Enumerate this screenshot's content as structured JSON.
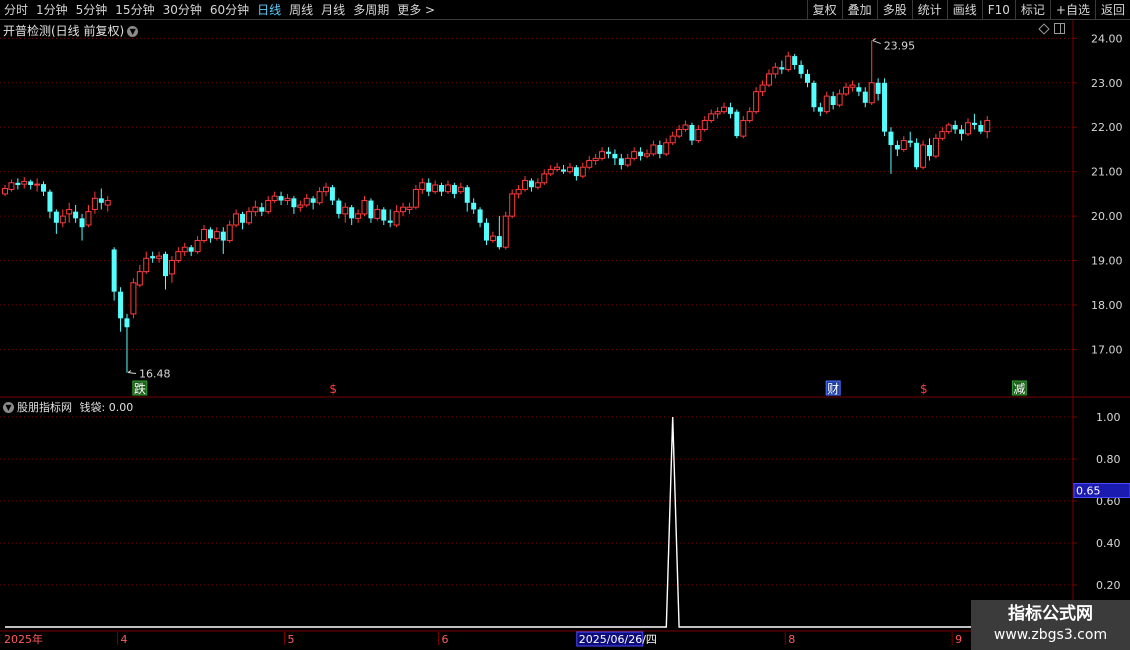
{
  "toolbar": {
    "periods": [
      "分时",
      "1分钟",
      "5分钟",
      "15分钟",
      "30分钟",
      "60分钟",
      "日线",
      "周线",
      "月线",
      "多周期",
      "更多 >"
    ],
    "active_period": "日线",
    "tools": [
      "复权",
      "叠加",
      "多股",
      "统计",
      "画线",
      "F10",
      "标记",
      "+自选",
      "返回"
    ]
  },
  "main_panel": {
    "title": "开普检测(日线 前复权)",
    "high_label": "23.95",
    "low_label": "16.48",
    "markers": [
      {
        "text": "跌",
        "style": "box-green"
      },
      {
        "text": "$",
        "style": "red"
      },
      {
        "text": "财",
        "style": "box-blue"
      },
      {
        "text": "$",
        "style": "red"
      },
      {
        "text": "减",
        "style": "box-green"
      }
    ]
  },
  "indicator_panel": {
    "title": "股朋指标网",
    "series_label": "钱袋:",
    "series_value": "0.00",
    "current_marker": "0.65"
  },
  "x_axis": {
    "labels": [
      "2025年",
      "4",
      "5",
      "6",
      "2025/06/26/四",
      "8",
      "9"
    ],
    "highlight": "2025/06/26/四"
  },
  "watermark": {
    "title": "指标公式网",
    "url": "www.zbgs3.com"
  },
  "colors": {
    "up": "#ff3b3b",
    "down": "#54ffff",
    "grid": "#6e0000",
    "axis": "#7a0000",
    "active_tab": "#5bd1ff"
  },
  "chart_data": [
    {
      "type": "candlestick",
      "title": "开普检测(日线 前复权)",
      "ylim": [
        16.2,
        24.3
      ],
      "y_ticks": [
        "17.00",
        "18.00",
        "19.00",
        "20.00",
        "21.00",
        "22.00",
        "23.00",
        "24.00"
      ],
      "annotations": [
        {
          "text": "23.95",
          "value": 23.95
        },
        {
          "text": "16.48",
          "value": 16.48
        }
      ],
      "candles": [
        [
          20.5,
          20.62,
          20.45,
          20.7
        ],
        [
          20.6,
          20.75,
          20.55,
          20.82
        ],
        [
          20.75,
          20.7,
          20.6,
          20.85
        ],
        [
          20.72,
          20.78,
          20.62,
          20.88
        ],
        [
          20.78,
          20.7,
          20.6,
          20.82
        ],
        [
          20.7,
          20.72,
          20.55,
          20.85
        ],
        [
          20.72,
          20.55,
          20.45,
          20.78
        ],
        [
          20.55,
          20.1,
          19.95,
          20.6
        ],
        [
          20.1,
          19.85,
          19.6,
          20.15
        ],
        [
          19.85,
          20.0,
          19.75,
          20.15
        ],
        [
          20.05,
          20.15,
          19.85,
          20.3
        ],
        [
          20.1,
          19.95,
          19.85,
          20.25
        ],
        [
          19.95,
          19.75,
          19.45,
          20.05
        ],
        [
          19.8,
          20.1,
          19.75,
          20.25
        ],
        [
          20.15,
          20.4,
          20.05,
          20.55
        ],
        [
          20.4,
          20.3,
          20.15,
          20.62
        ],
        [
          20.25,
          20.35,
          20.1,
          20.45
        ],
        [
          19.25,
          18.3,
          18.1,
          19.3
        ],
        [
          18.3,
          17.7,
          17.4,
          18.4
        ],
        [
          17.7,
          17.5,
          16.48,
          17.8
        ],
        [
          17.8,
          18.5,
          17.7,
          18.6
        ],
        [
          18.45,
          18.75,
          18.4,
          18.9
        ],
        [
          18.75,
          19.05,
          18.7,
          19.2
        ],
        [
          19.1,
          19.05,
          18.95,
          19.2
        ],
        [
          19.05,
          19.1,
          18.95,
          19.2
        ],
        [
          19.15,
          18.65,
          18.35,
          19.2
        ],
        [
          18.7,
          19.0,
          18.5,
          19.1
        ],
        [
          19.0,
          19.2,
          18.95,
          19.3
        ],
        [
          19.2,
          19.3,
          19.1,
          19.4
        ],
        [
          19.3,
          19.2,
          19.1,
          19.35
        ],
        [
          19.2,
          19.45,
          19.15,
          19.55
        ],
        [
          19.45,
          19.7,
          19.4,
          19.8
        ],
        [
          19.7,
          19.5,
          19.4,
          19.75
        ],
        [
          19.5,
          19.65,
          19.45,
          19.75
        ],
        [
          19.65,
          19.45,
          19.15,
          19.75
        ],
        [
          19.45,
          19.8,
          19.4,
          19.9
        ],
        [
          19.8,
          20.05,
          19.75,
          20.15
        ],
        [
          20.05,
          19.85,
          19.7,
          20.1
        ],
        [
          19.85,
          20.1,
          19.8,
          20.2
        ],
        [
          20.1,
          20.2,
          20.0,
          20.35
        ],
        [
          20.2,
          20.1,
          20.0,
          20.3
        ],
        [
          20.1,
          20.35,
          20.05,
          20.45
        ],
        [
          20.35,
          20.45,
          20.3,
          20.55
        ],
        [
          20.45,
          20.35,
          20.25,
          20.55
        ],
        [
          20.35,
          20.4,
          20.25,
          20.5
        ],
        [
          20.4,
          20.2,
          20.05,
          20.45
        ],
        [
          20.2,
          20.25,
          20.1,
          20.35
        ],
        [
          20.25,
          20.4,
          20.2,
          20.5
        ],
        [
          20.4,
          20.3,
          20.15,
          20.45
        ],
        [
          20.3,
          20.55,
          20.25,
          20.65
        ],
        [
          20.55,
          20.65,
          20.45,
          20.75
        ],
        [
          20.65,
          20.35,
          20.25,
          20.7
        ],
        [
          20.35,
          20.05,
          19.95,
          20.4
        ],
        [
          20.05,
          20.2,
          19.85,
          20.3
        ],
        [
          20.2,
          19.95,
          19.8,
          20.25
        ],
        [
          19.95,
          20.05,
          19.85,
          20.15
        ],
        [
          20.05,
          20.35,
          20.0,
          20.45
        ],
        [
          20.35,
          19.95,
          19.85,
          20.4
        ],
        [
          19.95,
          20.15,
          19.9,
          20.25
        ],
        [
          20.15,
          19.9,
          19.8,
          20.2
        ],
        [
          19.9,
          19.85,
          19.75,
          20.15
        ],
        [
          19.8,
          20.1,
          19.75,
          20.25
        ],
        [
          20.1,
          20.2,
          20.0,
          20.3
        ],
        [
          20.15,
          20.2,
          20.05,
          20.3
        ],
        [
          20.2,
          20.6,
          20.15,
          20.7
        ],
        [
          20.6,
          20.75,
          20.5,
          20.85
        ],
        [
          20.75,
          20.55,
          20.45,
          20.85
        ],
        [
          20.55,
          20.7,
          20.5,
          20.8
        ],
        [
          20.7,
          20.55,
          20.45,
          20.75
        ],
        [
          20.55,
          20.7,
          20.5,
          20.8
        ],
        [
          20.7,
          20.5,
          20.4,
          20.75
        ],
        [
          20.55,
          20.65,
          20.5,
          20.75
        ],
        [
          20.65,
          20.3,
          20.1,
          20.7
        ],
        [
          20.3,
          20.15,
          20.05,
          20.4
        ],
        [
          20.15,
          19.85,
          19.75,
          20.2
        ],
        [
          19.85,
          19.45,
          19.35,
          19.95
        ],
        [
          19.45,
          19.55,
          19.4,
          19.65
        ],
        [
          19.55,
          19.3,
          19.25,
          20.0
        ],
        [
          19.3,
          20.0,
          19.25,
          20.1
        ],
        [
          20.0,
          20.5,
          19.95,
          20.6
        ],
        [
          20.5,
          20.6,
          20.4,
          20.7
        ],
        [
          20.6,
          20.8,
          20.55,
          20.9
        ],
        [
          20.8,
          20.65,
          20.55,
          20.85
        ],
        [
          20.65,
          20.75,
          20.6,
          20.85
        ],
        [
          20.75,
          20.95,
          20.7,
          21.05
        ],
        [
          20.95,
          21.05,
          20.9,
          21.15
        ],
        [
          21.05,
          21.1,
          21.0,
          21.2
        ],
        [
          21.05,
          21.0,
          20.95,
          21.15
        ],
        [
          21.0,
          21.1,
          20.95,
          21.2
        ],
        [
          21.1,
          20.9,
          20.8,
          21.15
        ],
        [
          20.9,
          21.1,
          20.85,
          21.2
        ],
        [
          21.1,
          21.25,
          21.05,
          21.35
        ],
        [
          21.25,
          21.3,
          21.15,
          21.4
        ],
        [
          21.3,
          21.45,
          21.25,
          21.55
        ],
        [
          21.45,
          21.4,
          21.3,
          21.55
        ],
        [
          21.4,
          21.3,
          21.15,
          21.5
        ],
        [
          21.3,
          21.15,
          21.05,
          21.4
        ],
        [
          21.15,
          21.3,
          21.1,
          21.4
        ],
        [
          21.3,
          21.45,
          21.25,
          21.55
        ],
        [
          21.45,
          21.35,
          21.25,
          21.55
        ],
        [
          21.35,
          21.4,
          21.3,
          21.5
        ],
        [
          21.4,
          21.6,
          21.35,
          21.7
        ],
        [
          21.6,
          21.4,
          21.3,
          21.7
        ],
        [
          21.4,
          21.65,
          21.35,
          21.75
        ],
        [
          21.65,
          21.8,
          21.6,
          21.9
        ],
        [
          21.8,
          21.95,
          21.75,
          22.05
        ],
        [
          21.95,
          22.05,
          21.9,
          22.15
        ],
        [
          22.05,
          21.7,
          21.6,
          22.1
        ],
        [
          21.7,
          21.95,
          21.65,
          22.05
        ],
        [
          21.95,
          22.15,
          21.9,
          22.25
        ],
        [
          22.15,
          22.3,
          22.1,
          22.4
        ],
        [
          22.3,
          22.35,
          22.2,
          22.45
        ],
        [
          22.35,
          22.45,
          22.3,
          22.55
        ],
        [
          22.45,
          22.3,
          22.2,
          22.55
        ],
        [
          22.35,
          21.8,
          21.75,
          22.4
        ],
        [
          21.8,
          22.15,
          21.75,
          22.25
        ],
        [
          22.15,
          22.35,
          22.1,
          22.45
        ],
        [
          22.35,
          22.8,
          22.3,
          22.9
        ],
        [
          22.8,
          22.95,
          22.7,
          23.05
        ],
        [
          22.95,
          23.2,
          22.9,
          23.3
        ],
        [
          23.2,
          23.35,
          23.1,
          23.45
        ],
        [
          23.35,
          23.3,
          23.2,
          23.5
        ],
        [
          23.3,
          23.6,
          23.25,
          23.7
        ],
        [
          23.6,
          23.4,
          23.3,
          23.65
        ],
        [
          23.4,
          23.2,
          23.1,
          23.5
        ],
        [
          23.2,
          23.0,
          22.9,
          23.3
        ],
        [
          23.0,
          22.45,
          22.35,
          23.05
        ],
        [
          22.45,
          22.35,
          22.25,
          22.55
        ],
        [
          22.35,
          22.7,
          22.3,
          22.8
        ],
        [
          22.7,
          22.5,
          22.4,
          22.8
        ],
        [
          22.5,
          22.75,
          22.45,
          22.85
        ],
        [
          22.75,
          22.9,
          22.7,
          23.0
        ],
        [
          22.9,
          22.95,
          22.8,
          23.05
        ],
        [
          22.9,
          22.8,
          22.7,
          23.0
        ],
        [
          22.8,
          22.55,
          22.45,
          22.9
        ],
        [
          22.55,
          23.0,
          22.5,
          23.95
        ],
        [
          23.0,
          22.75,
          22.6,
          23.1
        ],
        [
          23.0,
          21.9,
          21.8,
          23.1
        ],
        [
          21.9,
          21.6,
          20.95,
          22.0
        ],
        [
          21.6,
          21.5,
          21.35,
          21.7
        ],
        [
          21.5,
          21.7,
          21.45,
          21.8
        ],
        [
          21.7,
          21.65,
          21.55,
          21.9
        ],
        [
          21.65,
          21.1,
          21.05,
          21.75
        ],
        [
          21.1,
          21.6,
          21.05,
          21.7
        ],
        [
          21.6,
          21.35,
          21.25,
          21.75
        ],
        [
          21.35,
          21.75,
          21.3,
          21.85
        ],
        [
          21.75,
          21.9,
          21.7,
          22.0
        ],
        [
          21.9,
          22.05,
          21.85,
          22.1
        ],
        [
          22.05,
          21.95,
          21.85,
          22.15
        ],
        [
          21.95,
          21.85,
          21.7,
          22.05
        ],
        [
          21.85,
          22.1,
          21.8,
          22.2
        ],
        [
          22.1,
          22.05,
          21.95,
          22.3
        ],
        [
          22.05,
          21.9,
          21.85,
          22.15
        ],
        [
          21.9,
          22.15,
          21.75,
          22.25
        ]
      ]
    },
    {
      "type": "line",
      "title": "股朋指标网",
      "series": [
        {
          "name": "钱袋",
          "values": [
            0,
            0,
            0,
            0,
            0,
            0,
            0,
            0,
            0,
            0,
            0,
            0,
            0,
            0,
            0,
            0,
            0,
            0,
            0,
            0,
            0,
            0,
            0,
            0,
            0,
            0,
            0,
            0,
            0,
            0,
            0,
            0,
            0,
            0,
            0,
            0,
            0,
            0,
            0,
            0,
            0,
            0,
            0,
            0,
            0,
            0,
            0,
            0,
            0,
            0,
            0,
            0,
            0,
            0,
            0,
            0,
            0,
            0,
            0,
            0,
            0,
            0,
            0,
            0,
            0,
            0,
            0,
            0,
            0,
            0,
            0,
            0,
            0,
            0,
            0,
            0,
            0,
            0,
            0,
            0,
            0,
            0,
            0,
            0,
            0,
            0,
            0,
            0,
            0,
            0,
            0,
            0,
            0,
            0,
            0,
            0,
            0,
            0,
            0,
            0,
            0,
            0,
            0,
            0,
            1,
            0,
            0,
            0,
            0,
            0,
            0,
            0,
            0,
            0,
            0,
            0,
            0,
            0,
            0,
            0,
            0,
            0,
            0,
            0,
            0,
            0,
            0,
            0,
            0,
            0,
            0,
            0,
            0,
            0,
            0,
            0,
            0,
            0,
            0,
            0,
            0,
            0,
            0,
            0,
            0,
            0,
            0,
            0,
            0,
            0,
            0,
            0,
            0,
            0,
            0,
            0,
            0,
            0,
            0,
            0,
            0,
            0,
            0,
            0
          ]
        }
      ],
      "ylim": [
        0,
        1.1
      ],
      "y_ticks": [
        "0.20",
        "0.40",
        "0.60",
        "0.80",
        "1.00"
      ]
    }
  ]
}
